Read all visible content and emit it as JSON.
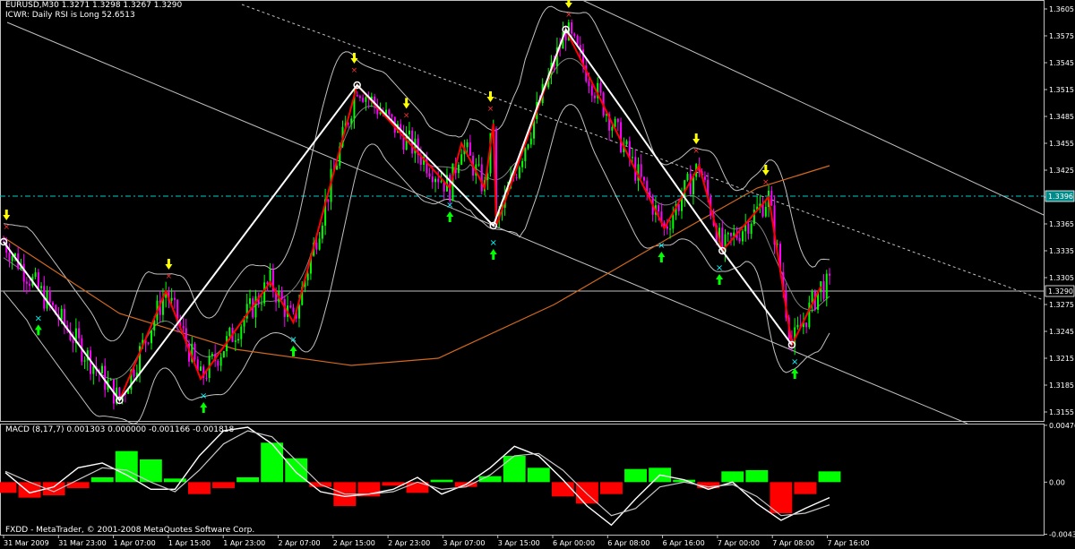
{
  "header": {
    "symbol_line": "EURUSD,M30  1.3271 1.3298 1.3267 1.3290",
    "indicator_line": "ICWR: Daily RSI is Long 52.6513"
  },
  "macd_header": "MACD  (8,17,7) 0.001303 0.000000 -0.001166 -0.001818",
  "footer": "FXDD - MetaTrader, © 2001-2008 MetaQuotes Software Corp.",
  "colors": {
    "up_candle": "#00ff00",
    "down_candle": "#ff00ff",
    "zigzag": "#ffffff",
    "zigzag_secondary": "#ff0000",
    "bands": "#c0c0c0",
    "ma": "#d2691e",
    "level_line": "#00cccc",
    "down_arrow": "#ffff00",
    "up_arrow": "#00ff00",
    "marker_x_top": "#ff3030",
    "marker_x_bottom": "#00ffff",
    "hist_pos": "#00ff00",
    "hist_neg": "#ff0000"
  },
  "chart_data": [
    {
      "type": "candlestick",
      "title": "EURUSD,M30",
      "ylim": [
        1.3145,
        1.3615
      ],
      "y_ticks": [
        "1.3605",
        "1.3575",
        "1.3545",
        "1.3515",
        "1.3485",
        "1.3455",
        "1.3425",
        "1.3395",
        "1.3365",
        "1.3335",
        "1.3305",
        "1.3275",
        "1.3245",
        "1.3215",
        "1.3185",
        "1.3155"
      ],
      "current_price": "1.3290",
      "level_line_price": "1.3396",
      "x_labels": [
        "31 Mar 2009",
        "31 Mar 23:00",
        "1 Apr 07:00",
        "1 Apr 15:00",
        "1 Apr 23:00",
        "2 Apr 07:00",
        "2 Apr 15:00",
        "2 Apr 23:00",
        "3 Apr 07:00",
        "3 Apr 15:00",
        "6 Apr 00:00",
        "6 Apr 08:00",
        "6 Apr 16:00",
        "7 Apr 00:00",
        "7 Apr 08:00",
        "7 Apr 16:00"
      ],
      "zigzag_main": [
        {
          "i": 0,
          "price": 1.3345
        },
        {
          "i": 40,
          "price": 1.3168
        },
        {
          "i": 122,
          "price": 1.352
        },
        {
          "i": 169,
          "price": 1.3363
        },
        {
          "i": 194,
          "price": 1.3582
        },
        {
          "i": 248,
          "price": 1.3335
        },
        {
          "i": 272,
          "price": 1.323
        }
      ],
      "zigzag_secondary": [
        {
          "i": 40,
          "price": 1.3168
        },
        {
          "i": 56,
          "price": 1.329
        },
        {
          "i": 68,
          "price": 1.3192
        },
        {
          "i": 92,
          "price": 1.33
        },
        {
          "i": 100,
          "price": 1.3255
        },
        {
          "i": 122,
          "price": 1.352
        },
        {
          "i": 154,
          "price": 1.3405
        },
        {
          "i": 158,
          "price": 1.3455
        },
        {
          "i": 166,
          "price": 1.3405
        },
        {
          "i": 169,
          "price": 1.3477
        },
        {
          "i": 170,
          "price": 1.3363
        },
        {
          "i": 194,
          "price": 1.3582
        },
        {
          "i": 228,
          "price": 1.336
        },
        {
          "i": 240,
          "price": 1.343
        },
        {
          "i": 248,
          "price": 1.3335
        },
        {
          "i": 264,
          "price": 1.3395
        },
        {
          "i": 272,
          "price": 1.323
        },
        {
          "i": 282,
          "price": 1.3295
        }
      ],
      "moving_average": [
        {
          "i": 0,
          "price": 1.335
        },
        {
          "i": 40,
          "price": 1.3265
        },
        {
          "i": 80,
          "price": 1.3225
        },
        {
          "i": 120,
          "price": 1.3207
        },
        {
          "i": 150,
          "price": 1.3215
        },
        {
          "i": 190,
          "price": 1.3275
        },
        {
          "i": 230,
          "price": 1.335
        },
        {
          "i": 260,
          "price": 1.3405
        },
        {
          "i": 285,
          "price": 1.343
        }
      ],
      "down_arrows": [
        1,
        57,
        121,
        139,
        168,
        195,
        239,
        263
      ],
      "up_arrows": [
        12,
        69,
        100,
        154,
        169,
        227,
        247,
        273
      ]
    },
    {
      "type": "bar",
      "title": "MACD  (8,17,7)",
      "ylim": [
        -0.0044,
        0.0049
      ],
      "y_ticks": [
        "0.00476",
        "0.00",
        "-0.00436"
      ],
      "values": [
        -0.0009,
        -0.0013,
        -0.0011,
        -0.0005,
        0.0004,
        0.0026,
        0.0019,
        0.0003,
        -0.001,
        -0.0005,
        0.0004,
        0.0033,
        0.002,
        -0.0004,
        -0.002,
        -0.0012,
        -0.0003,
        -0.0009,
        0.0002,
        -0.0004,
        0.0005,
        0.0022,
        0.0012,
        -0.0012,
        -0.0018,
        -0.001,
        0.0011,
        0.0012,
        0.0002,
        -0.0005,
        0.0009,
        0.001,
        -0.0026,
        -0.001,
        0.0009
      ],
      "macd_line": [
        0.0008,
        -0.0009,
        -0.0004,
        0.0012,
        0.0016,
        0.0006,
        -0.0006,
        -0.0006,
        0.0022,
        0.0043,
        0.0046,
        0.0032,
        0.0008,
        -0.0008,
        -0.0012,
        -0.001,
        -0.0006,
        0.0004,
        -0.001,
        -0.0002,
        0.0012,
        0.003,
        0.0022,
        0.0002,
        -0.002,
        -0.0036,
        -0.0014,
        0.0006,
        0.0002,
        -0.0006,
        0.0,
        -0.0018,
        -0.0032,
        -0.0022,
        -0.0013
      ],
      "signal_line": [
        0.0009,
        0.0,
        -0.0008,
        0.0002,
        0.0012,
        0.001,
        0.0,
        -0.0008,
        0.001,
        0.0032,
        0.0043,
        0.0038,
        0.0018,
        -0.0002,
        -0.001,
        -0.001,
        -0.0008,
        0.0,
        -0.0006,
        -0.0004,
        0.0006,
        0.0022,
        0.0024,
        0.001,
        -0.001,
        -0.0028,
        -0.0022,
        -0.0004,
        0.0,
        -0.0004,
        -0.0002,
        -0.0012,
        -0.0028,
        -0.0026,
        -0.0019
      ]
    }
  ]
}
